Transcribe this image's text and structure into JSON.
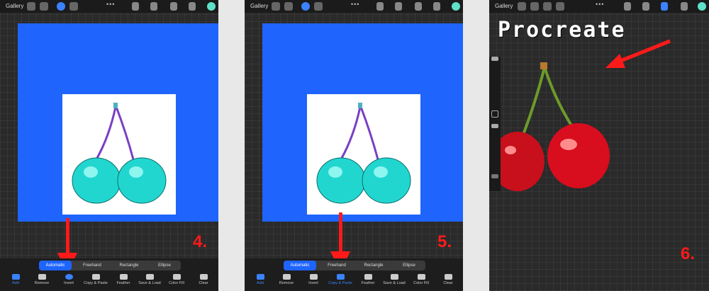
{
  "panels": [
    {
      "gallery_label": "Gallery",
      "step_label": "4.",
      "segments": [
        {
          "label": "Automatic",
          "active": true
        },
        {
          "label": "Freehand",
          "active": false
        },
        {
          "label": "Rectangle",
          "active": false
        },
        {
          "label": "Ellipse",
          "active": false
        }
      ],
      "tools": [
        {
          "label": "Add"
        },
        {
          "label": "Remove"
        },
        {
          "label": "Invert"
        },
        {
          "label": "Copy & Paste"
        },
        {
          "label": "Feather"
        },
        {
          "label": "Save & Load"
        },
        {
          "label": "Color Fill"
        },
        {
          "label": "Clear"
        }
      ]
    },
    {
      "gallery_label": "Gallery",
      "step_label": "5.",
      "segments": [
        {
          "label": "Automatic",
          "active": true
        },
        {
          "label": "Freehand",
          "active": false
        },
        {
          "label": "Rectangle",
          "active": false
        },
        {
          "label": "Ellipse",
          "active": false
        }
      ],
      "tools": [
        {
          "label": "Add"
        },
        {
          "label": "Remove"
        },
        {
          "label": "Invert"
        },
        {
          "label": "Copy & Paste"
        },
        {
          "label": "Feather"
        },
        {
          "label": "Save & Load"
        },
        {
          "label": "Color Fill"
        },
        {
          "label": "Clear"
        }
      ]
    },
    {
      "gallery_label": "Gallery",
      "step_label": "6.",
      "title": "Procreate"
    }
  ],
  "colors": {
    "canvas_blue": "#1f64fd",
    "arrow_red": "#ff1a1a",
    "cyan_cherry": "#22d6d0",
    "red_cherry": "#d80d1e"
  }
}
